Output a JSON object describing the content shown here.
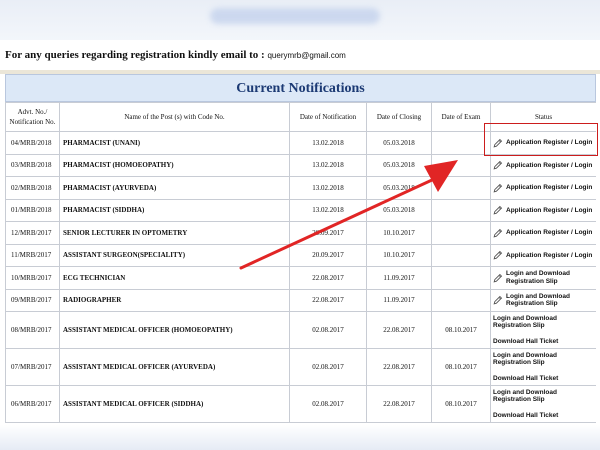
{
  "query_text": "For any queries regarding registration kindly email to :",
  "email": "querymrb@gmail.com",
  "section_title": "Current Notifications",
  "headers": [
    "Advt. No./ Notification No.",
    "Name of the Post (s) with Code No.",
    "Date of Notification",
    "Date of Closing",
    "Date of Exam",
    "Status"
  ],
  "rows": [
    {
      "advt": "04/MRB/2018",
      "post": "PHARMACIST (UNANI)",
      "notif": "13.02.2018",
      "close": "05.03.2018",
      "exam": "",
      "status": "Application Register / Login"
    },
    {
      "advt": "03/MRB/2018",
      "post": "PHARMACIST (HOMOEOPATHY)",
      "notif": "13.02.2018",
      "close": "05.03.2018",
      "exam": "",
      "status": "Application Register / Login"
    },
    {
      "advt": "02/MRB/2018",
      "post": "PHARMACIST (AYURVEDA)",
      "notif": "13.02.2018",
      "close": "05.03.2018",
      "exam": "",
      "status": "Application Register / Login"
    },
    {
      "advt": "01/MRB/2018",
      "post": "PHARMACIST (SIDDHA)",
      "notif": "13.02.2018",
      "close": "05.03.2018",
      "exam": "",
      "status": "Application Register / Login"
    },
    {
      "advt": "12/MRB/2017",
      "post": "SENIOR LECTURER IN OPTOMETRY",
      "notif": "20.09.2017",
      "close": "10.10.2017",
      "exam": "",
      "status": "Application Register / Login"
    },
    {
      "advt": "11/MRB/2017",
      "post": "ASSISTANT SURGEON(SPECIALITY)",
      "notif": "20.09.2017",
      "close": "10.10.2017",
      "exam": "",
      "status": "Application Register / Login"
    },
    {
      "advt": "10/MRB/2017",
      "post": "ECG TECHNICIAN",
      "notif": "22.08.2017",
      "close": "11.09.2017",
      "exam": "",
      "status": "Login and Download Registration Slip"
    },
    {
      "advt": "09/MRB/2017",
      "post": "RADIOGRAPHER",
      "notif": "22.08.2017",
      "close": "11.09.2017",
      "exam": "",
      "status": "Login and Download Registration Slip"
    },
    {
      "advt": "08/MRB/2017",
      "post": "ASSISTANT MEDICAL OFFICER (HOMOEOPATHY)",
      "notif": "02.08.2017",
      "close": "22.08.2017",
      "exam": "08.10.2017",
      "status": "Login and Download Registration Slip",
      "ticket": "Download Hall Ticket"
    },
    {
      "advt": "07/MRB/2017",
      "post": "ASSISTANT MEDICAL OFFICER (AYURVEDA)",
      "notif": "02.08.2017",
      "close": "22.08.2017",
      "exam": "08.10.2017",
      "status": "Login and Download Registration Slip",
      "ticket": "Download Hall Ticket"
    },
    {
      "advt": "06/MRB/2017",
      "post": "ASSISTANT MEDICAL OFFICER (SIDDHA)",
      "notif": "02.08.2017",
      "close": "22.08.2017",
      "exam": "08.10.2017",
      "status": "Login and Download Registration Slip",
      "ticket": "Download Hall Ticket"
    }
  ],
  "icons": {
    "status_link": "pencil-icon"
  },
  "colors": {
    "title_bar": "#dce8f7",
    "title_text": "#1c3a74",
    "annotation": "#cc1d1d"
  }
}
